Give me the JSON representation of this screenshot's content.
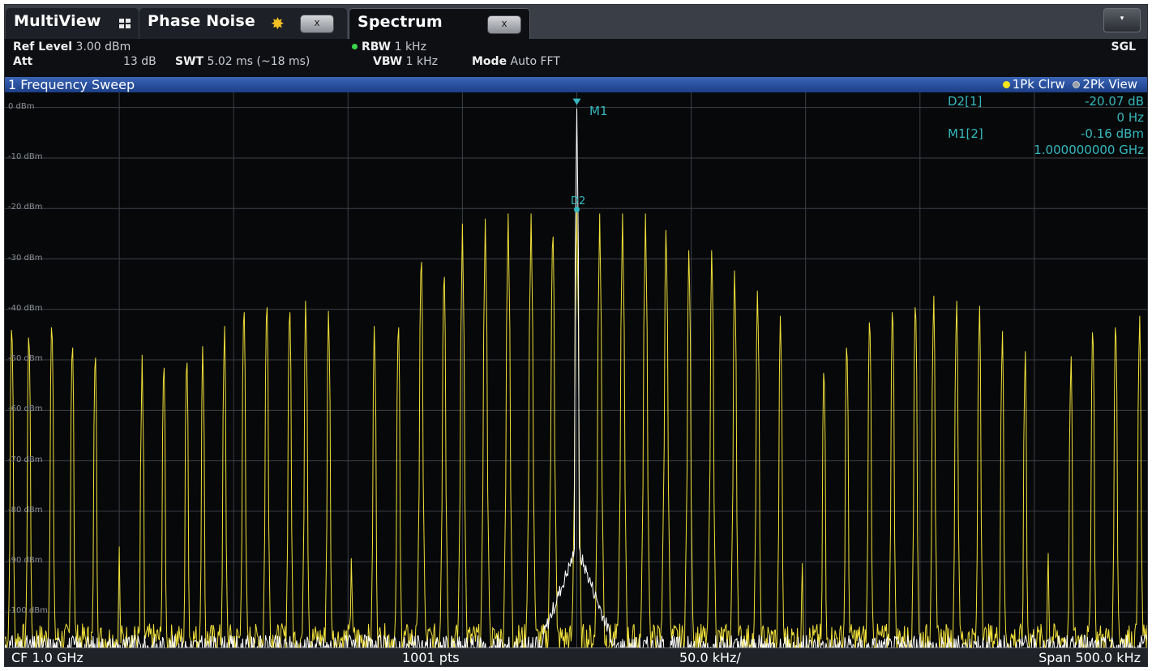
{
  "tabs": {
    "multiview": {
      "label": "MultiView",
      "icon": "grid-icon"
    },
    "phase_noise": {
      "label": "Phase Noise",
      "icon": "star-icon",
      "close": "x"
    },
    "spectrum": {
      "label": "Spectrum",
      "close": "x"
    },
    "menu": {
      "icon": "dropdown-arrow-icon",
      "glyph": "▾"
    }
  },
  "settings": {
    "ref_level_label": "Ref Level",
    "ref_level_value": "3.00 dBm",
    "att_label": "Att",
    "att_value": "13 dB",
    "swt_label": "SWT",
    "swt_value": "5.02 ms (~18 ms)",
    "rbw_label": "RBW",
    "rbw_value": "1 kHz",
    "vbw_label": "VBW",
    "vbw_value": "1 kHz",
    "mode_label": "Mode",
    "mode_value": "Auto FFT",
    "sgl": "SGL"
  },
  "window": {
    "title": "1 Frequency Sweep",
    "trace1": "1Pk Clrw",
    "trace2": "2Pk View"
  },
  "chart_data": {
    "type": "line",
    "y_unit": "dBm",
    "y_ticks": [
      "0 dBm",
      "-10 dBm",
      "-20 dBm",
      "-30 dBm",
      "-40 dBm",
      "-50 dBm",
      "-60 dBm",
      "-70 dBm",
      "-80 dBm",
      "-90 dBm",
      "-100 dBm"
    ],
    "ylim": [
      -107,
      3
    ],
    "x_divisions": 10,
    "grid": true,
    "center_freq": "CF 1.0 GHz",
    "points": "1001 pts",
    "div": "50.0 kHz/",
    "span": "Span 500.0 kHz",
    "carrier_level": -0.16,
    "noise_floor": -104,
    "series": [
      {
        "name": "1Pk Clrw",
        "color": "#f0e03a",
        "peaks": [
          {
            "x": 0.006,
            "y": -39.5
          },
          {
            "x": 0.021,
            "y": -41
          },
          {
            "x": 0.041,
            "y": -39
          },
          {
            "x": 0.059,
            "y": -43
          },
          {
            "x": 0.079,
            "y": -45
          },
          {
            "x": 0.1,
            "y": -87
          },
          {
            "x": 0.12,
            "y": -49
          },
          {
            "x": 0.139,
            "y": -47
          },
          {
            "x": 0.159,
            "y": -46
          },
          {
            "x": 0.173,
            "y": -45
          },
          {
            "x": 0.192,
            "y": -41
          },
          {
            "x": 0.209,
            "y": -36
          },
          {
            "x": 0.229,
            "y": -35
          },
          {
            "x": 0.249,
            "y": -36
          },
          {
            "x": 0.263,
            "y": -36
          },
          {
            "x": 0.283,
            "y": -38
          },
          {
            "x": 0.303,
            "y": -87
          },
          {
            "x": 0.323,
            "y": -41
          },
          {
            "x": 0.344,
            "y": -39
          },
          {
            "x": 0.364,
            "y": -26
          },
          {
            "x": 0.384,
            "y": -29
          },
          {
            "x": 0.4,
            "y": -23
          },
          {
            "x": 0.42,
            "y": -22
          },
          {
            "x": 0.44,
            "y": -21
          },
          {
            "x": 0.46,
            "y": -21
          },
          {
            "x": 0.479,
            "y": -21
          },
          {
            "x": 0.5,
            "y": -20.2
          },
          {
            "x": 0.52,
            "y": -21
          },
          {
            "x": 0.54,
            "y": -21
          },
          {
            "x": 0.56,
            "y": -21
          },
          {
            "x": 0.578,
            "y": -22
          },
          {
            "x": 0.598,
            "y": -26
          },
          {
            "x": 0.618,
            "y": -26
          },
          {
            "x": 0.638,
            "y": -30
          },
          {
            "x": 0.658,
            "y": -34
          },
          {
            "x": 0.678,
            "y": -39
          },
          {
            "x": 0.697,
            "y": -88
          },
          {
            "x": 0.716,
            "y": -48
          },
          {
            "x": 0.736,
            "y": -43
          },
          {
            "x": 0.756,
            "y": -38
          },
          {
            "x": 0.776,
            "y": -36
          },
          {
            "x": 0.796,
            "y": -35
          },
          {
            "x": 0.812,
            "y": -35
          },
          {
            "x": 0.832,
            "y": -36
          },
          {
            "x": 0.852,
            "y": -37
          },
          {
            "x": 0.872,
            "y": -42
          },
          {
            "x": 0.892,
            "y": -46
          },
          {
            "x": 0.912,
            "y": -86
          },
          {
            "x": 0.932,
            "y": -47
          },
          {
            "x": 0.951,
            "y": -40
          },
          {
            "x": 0.971,
            "y": -39
          },
          {
            "x": 0.992,
            "y": -39
          }
        ]
      },
      {
        "name": "2Pk View",
        "color": "#ffffff",
        "peaks": [
          {
            "x": 0.5,
            "y": -0.16
          },
          {
            "x": 0.49,
            "y": -87
          },
          {
            "x": 0.51,
            "y": -92
          }
        ]
      }
    ]
  },
  "markers": {
    "m1_label": "M1",
    "d2_label": "D2",
    "table": {
      "d2_name": "D2[1]",
      "d2_level": "-20.07 dB",
      "d2_freq": "0 Hz",
      "m1_name": "M1[2]",
      "m1_level": "-0.16 dBm",
      "m1_freq": "1.000000000 GHz"
    }
  }
}
